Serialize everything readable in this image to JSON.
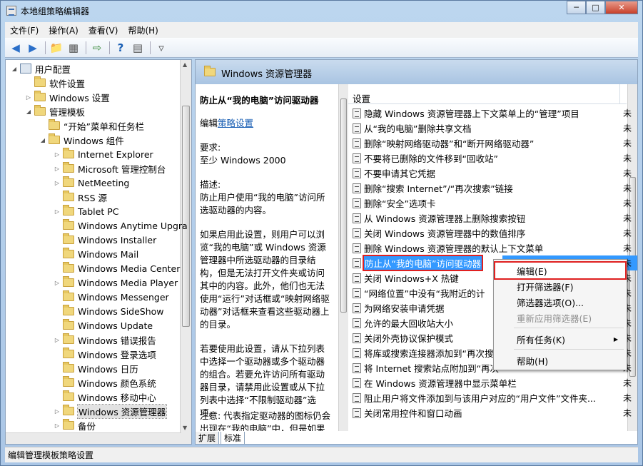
{
  "window": {
    "title": "本地组策略编辑器",
    "minimize": "─",
    "maximize": "□",
    "close": "✕"
  },
  "menu": [
    "文件(F)",
    "操作(A)",
    "查看(V)",
    "帮助(H)"
  ],
  "toolbar": [
    "back-arrow-icon",
    "forward-arrow-icon",
    "up-folder-icon",
    "show-hide-tree-icon",
    "export-list-icon",
    "help-icon",
    "properties-icon",
    "filter-icon"
  ],
  "tree": [
    {
      "label": "用户配置",
      "level": 0,
      "twisty": "open",
      "icon": "computer"
    },
    {
      "label": "软件设置",
      "level": 1,
      "twisty": "none"
    },
    {
      "label": "Windows 设置",
      "level": 1,
      "twisty": "closed"
    },
    {
      "label": "管理模板",
      "level": 1,
      "twisty": "open"
    },
    {
      "label": "“开始”菜单和任务栏",
      "level": 2,
      "twisty": "none"
    },
    {
      "label": "Windows 组件",
      "level": 2,
      "twisty": "open"
    },
    {
      "label": "Internet Explorer",
      "level": 3,
      "twisty": "closed"
    },
    {
      "label": "Microsoft 管理控制台",
      "level": 3,
      "twisty": "closed"
    },
    {
      "label": "NetMeeting",
      "level": 3,
      "twisty": "closed"
    },
    {
      "label": "RSS 源",
      "level": 3,
      "twisty": "none"
    },
    {
      "label": "Tablet PC",
      "level": 3,
      "twisty": "closed"
    },
    {
      "label": "Windows Anytime Upgra",
      "level": 3,
      "twisty": "none"
    },
    {
      "label": "Windows Installer",
      "level": 3,
      "twisty": "none"
    },
    {
      "label": "Windows Mail",
      "level": 3,
      "twisty": "none"
    },
    {
      "label": "Windows Media Center",
      "level": 3,
      "twisty": "none"
    },
    {
      "label": "Windows Media Player",
      "level": 3,
      "twisty": "closed"
    },
    {
      "label": "Windows Messenger",
      "level": 3,
      "twisty": "none"
    },
    {
      "label": "Windows SideShow",
      "level": 3,
      "twisty": "none"
    },
    {
      "label": "Windows Update",
      "level": 3,
      "twisty": "none"
    },
    {
      "label": "Windows 错误报告",
      "level": 3,
      "twisty": "closed"
    },
    {
      "label": "Windows 登录选项",
      "level": 3,
      "twisty": "none"
    },
    {
      "label": "Windows 日历",
      "level": 3,
      "twisty": "none"
    },
    {
      "label": "Windows 颜色系统",
      "level": 3,
      "twisty": "none"
    },
    {
      "label": "Windows 移动中心",
      "level": 3,
      "twisty": "none"
    },
    {
      "label": "Windows 资源管理器",
      "level": 3,
      "twisty": "closed",
      "selected": true
    },
    {
      "label": "备份",
      "level": 3,
      "twisty": "closed"
    }
  ],
  "right": {
    "header": "Windows 资源管理器",
    "desc_title": "防止从“我的电脑”访问驱动器",
    "edit_prefix": "编辑",
    "edit_link": "策略设置",
    "req_label": "要求:",
    "req_value": "至少 Windows 2000",
    "desc_label": "描述:",
    "desc_body": "防止用户使用“我的电脑”访问所选驱动器的内容。",
    "desc_p2": "如果启用此设置，则用户可以浏览“我的电脑”或 Windows 资源管理器中所选驱动器的目录结构，但是无法打开文件夹或访问其中的内容。此外，他们也无法使用“运行”对话框或“映射网络驱动器”对话框来查看这些驱动器上的目录。",
    "desc_p3": "若要使用此设置，请从下拉列表中选择一个驱动器或多个驱动器的组合。若要允许访问所有驱动器目录，请禁用此设置或从下拉列表中选择“不限制驱动器”选项。",
    "desc_p4": "注意: 代表指定驱动器的图标仍会出现在“我的电脑”中，但是如果",
    "col_setting": "设置",
    "state": "未",
    "policies": [
      "隐藏 Windows 资源管理器上下文菜单上的“管理”项目",
      "从“我的电脑”删除共享文档",
      "删除“映射网络驱动器”和“断开网络驱动器”",
      "不要将已删除的文件移到“回收站”",
      "不要申请其它凭据",
      "删除“搜索 Internet”/“再次搜索”链接",
      "删除“安全”选项卡",
      "从 Windows 资源管理器上删除搜索按钮",
      "关闭 Windows 资源管理器中的数值排序",
      "删除 Windows 资源管理器的默认上下文菜单",
      "防止从“我的电脑”访问驱动器",
      "关闭 Windows+X 热键",
      "“网络位置”中没有“我附近的计",
      "为网络安装申请凭据",
      "允许的最大回收站大小",
      "关闭外壳协议保护模式",
      "将库或搜索连接器添加到“再次搜",
      "将 Internet 搜索站点附加到“再次",
      "在 Windows 资源管理器中显示菜单栏",
      "阻止用户将文件添加到与该用户对应的“用户文件”文件夹...",
      "关闭常用控件和窗口动画"
    ],
    "highlighted_index": 10
  },
  "context_menu": [
    {
      "label": "编辑(E)",
      "disabled": false,
      "boxed": true
    },
    {
      "label": "打开筛选器(F)",
      "disabled": false
    },
    {
      "label": "筛选器选项(O)...",
      "disabled": false
    },
    {
      "label": "重新应用筛选器(E)",
      "disabled": true
    },
    {
      "label": "所有任务(K)",
      "disabled": false,
      "submenu": true
    },
    {
      "label": "帮助(H)",
      "disabled": false
    }
  ],
  "tabs": [
    "扩展",
    "标准"
  ],
  "status": "编辑管理模板策略设置",
  "colors": {
    "selection": "#3399ff",
    "highlight_box": "#e02020",
    "link": "#1a5fb4",
    "header": "#b8cfe9"
  }
}
